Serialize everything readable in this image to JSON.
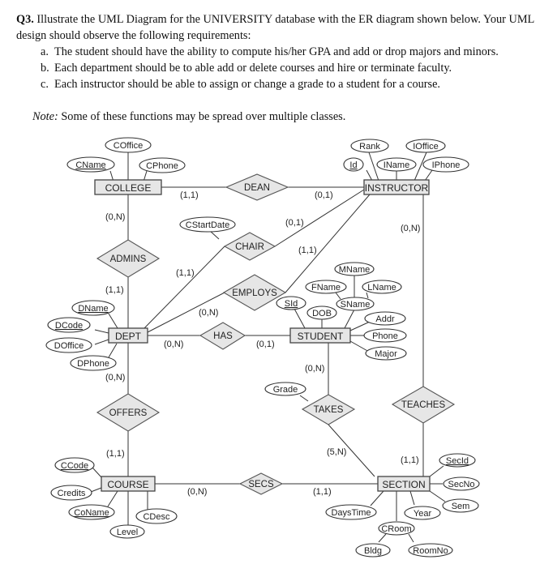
{
  "question": {
    "number": "Q3.",
    "intro": " Illustrate the UML Diagram for the UNIVERSITY database with the ER diagram shown below.  Your UML design should observe the following requirements:",
    "requirements": [
      {
        "label": "a.",
        "text": "The student should have the ability to compute his/her GPA and add or drop majors and minors."
      },
      {
        "label": "b.",
        "text": "Each department should be to able add or delete courses and hire or terminate faculty."
      },
      {
        "label": "c.",
        "text": "Each instructor should be able to assign or change a grade to a student for a course."
      }
    ],
    "note_label": "Note:",
    "note_text": " Some of these functions may be spread over multiple classes."
  },
  "diagram": {
    "entities": {
      "college": "COLLEGE",
      "instructor": "INSTRUCTOR",
      "dept": "DEPT",
      "student": "STUDENT",
      "course": "COURSE",
      "section": "SECTION"
    },
    "relationships": {
      "dean": "DEAN",
      "chair": "CHAIR",
      "admins": "ADMINS",
      "employs": "EMPLOYS",
      "has": "HAS",
      "offers": "OFFERS",
      "takes": "TAKES",
      "teaches": "TEACHES",
      "secs": "SECS"
    },
    "attributes": {
      "coffice": "COffice",
      "cname": "CName",
      "cphone": "CPhone",
      "rank": "Rank",
      "ioffice": "IOffice",
      "id": "Id",
      "iname": "IName",
      "iphone": "IPhone",
      "cstartdate": "CStartDate",
      "dname": "DName",
      "dcode": "DCode",
      "doffice": "DOffice",
      "dphone": "DPhone",
      "mname": "MName",
      "fname": "FName",
      "lname": "LName",
      "sname": "SName",
      "sid": "SId",
      "dob": "DOB",
      "addr": "Addr",
      "phone": "Phone",
      "major": "Major",
      "grade": "Grade",
      "ccode": "CCode",
      "credits": "Credits",
      "coname": "CoName",
      "level": "Level",
      "cdesc": "CDesc",
      "secid": "SecId",
      "secno": "SecNo",
      "sem": "Sem",
      "year": "Year",
      "daystime": "DaysTime",
      "croom": "CRoom",
      "bldg": "Bldg",
      "roomno": "RoomNo"
    },
    "cardinalities": {
      "college_dean": "(1,1)",
      "instructor_dean": "(0,1)",
      "college_admins": "(0,N)",
      "dept_admins": "(1,1)",
      "instructor_chair": "(0,1)",
      "dept_chair": "(1,1)",
      "instructor_employs": "(1,1)",
      "dept_employs": "(0,N)",
      "dept_has": "(0,N)",
      "student_has": "(0,1)",
      "instructor_teaches": "(0,N)",
      "section_teaches": "(1,1)",
      "student_takes": "(0,N)",
      "section_takes": "(5,N)",
      "dept_offers": "(0,N)",
      "course_offers": "(1,1)",
      "course_secs": "(0,N)",
      "section_secs": "(1,1)"
    }
  }
}
